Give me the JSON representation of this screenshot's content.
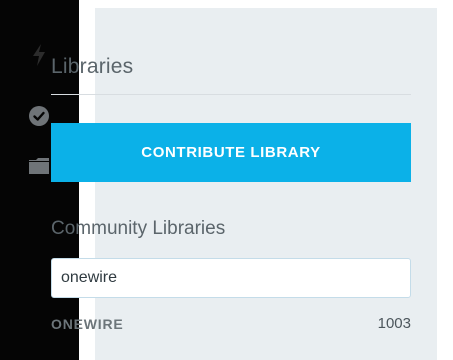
{
  "sidebar": {
    "icons": [
      {
        "name": "flash-icon"
      },
      {
        "name": "check-circle-icon"
      },
      {
        "name": "folder-icon"
      }
    ]
  },
  "panel": {
    "title": "Libraries",
    "contribute_label": "CONTRIBUTE LIBRARY",
    "community_label": "Community Libraries",
    "search": {
      "value": "onewire"
    },
    "results": [
      {
        "name": "ONEWIRE",
        "count": "1003"
      }
    ]
  },
  "colors": {
    "sidebar_bg": "#050505",
    "panel_bg": "#e9eef1",
    "accent": "#0bb1e8",
    "icon_muted": "#6f7478",
    "text": "#5b656b"
  }
}
